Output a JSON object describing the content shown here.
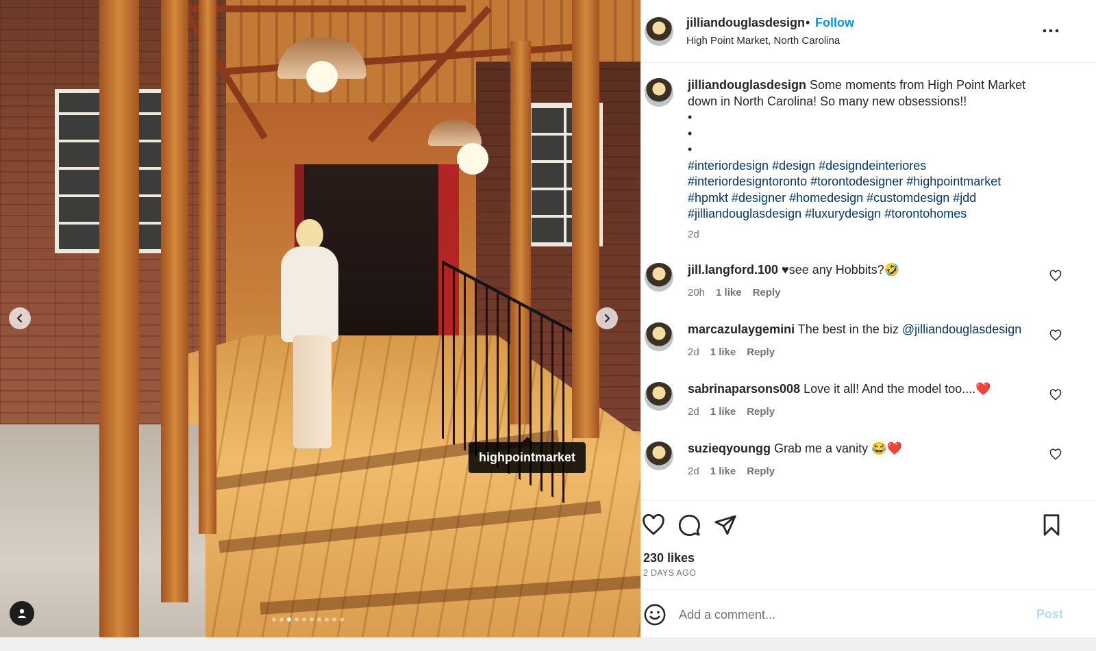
{
  "post": {
    "username": "jilliandouglasdesign",
    "separator": "•",
    "follow_label": "Follow",
    "location": "High Point Market, North Carolina"
  },
  "media": {
    "tag_label": "highpointmarket",
    "carousel_total": 10,
    "carousel_active": 3
  },
  "caption": {
    "username": "jilliandouglasdesign",
    "text": "Some moments from High Point Market down in North Carolina! So many new obsessions!!",
    "bullets": [
      "•",
      "•",
      "•"
    ],
    "hashtags_line1": "#interiordesign #design #designdeinteriores",
    "hashtags_line2": "#interiordesigntoronto #torontodesigner #highpointmarket",
    "hashtags_line3": "#hpmkt #designer #homedesign #customdesign #jdd",
    "hashtags_line4": "#jilliandouglasdesign #luxurydesign #torontohomes",
    "time": "2d"
  },
  "comments": [
    {
      "username": "jill.langford.100",
      "text": "♥see any Hobbits?🤣",
      "mention": "",
      "time": "20h",
      "likes": "1 like",
      "reply": "Reply"
    },
    {
      "username": "marcazulaygemini",
      "text": "The best in the biz ",
      "mention": "@jilliandouglasdesign",
      "time": "2d",
      "likes": "1 like",
      "reply": "Reply"
    },
    {
      "username": "sabrinaparsons008",
      "text": "Love it all! And the model too....❤️",
      "mention": "",
      "time": "2d",
      "likes": "1 like",
      "reply": "Reply"
    },
    {
      "username": "suzieqyoungg",
      "text": "Grab me a vanity 😂❤️",
      "mention": "",
      "time": "2d",
      "likes": "1 like",
      "reply": "Reply"
    }
  ],
  "actions": {
    "likes_count": "230 likes",
    "posted_ago": "2 DAYS AGO"
  },
  "add_comment": {
    "placeholder": "Add a comment...",
    "post_label": "Post"
  },
  "colors": {
    "link_blue": "#0095f6",
    "hashtag_blue": "#00376b",
    "muted_gray": "#737373",
    "post_disabled": "#b3dbff"
  },
  "icons": [
    "more-options-icon",
    "heart-icon",
    "comment-icon",
    "share-icon",
    "bookmark-icon",
    "emoji-icon",
    "chevron-left-icon",
    "chevron-right-icon",
    "user-tag-icon"
  ]
}
